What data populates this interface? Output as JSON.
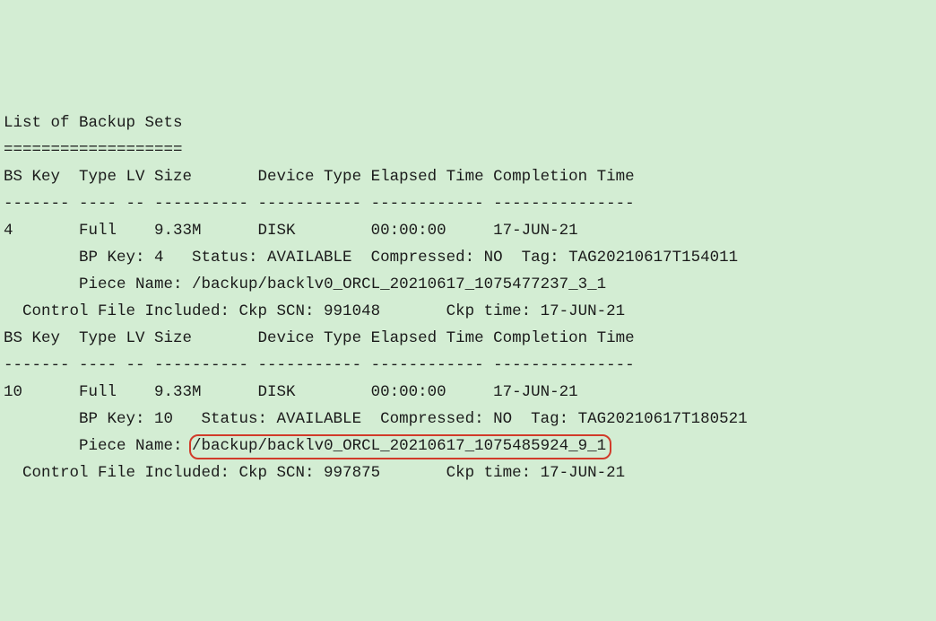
{
  "title": "List of Backup Sets",
  "divider": "===================",
  "header_line": "BS Key  Type LV Size       Device Type Elapsed Time Completion Time",
  "header_sep": "------- ---- -- ---------- ----------- ------------ ---------------",
  "sets": [
    {
      "summary_line": "4       Full    9.33M      DISK        00:00:00     17-JUN-21",
      "bp_line": "        BP Key: 4   Status: AVAILABLE  Compressed: NO  Tag: TAG20210617T154011",
      "piece_prefix": "        Piece Name: ",
      "piece_name": "/backup/backlv0_ORCL_20210617_1075477237_3_1",
      "piece_highlight": false,
      "control_line": "  Control File Included: Ckp SCN: 991048       Ckp time: 17-JUN-21"
    },
    {
      "summary_line": "10      Full    9.33M      DISK        00:00:00     17-JUN-21",
      "bp_line": "        BP Key: 10   Status: AVAILABLE  Compressed: NO  Tag: TAG20210617T180521",
      "piece_prefix": "        Piece Name: ",
      "piece_name": "/backup/backlv0_ORCL_20210617_1075485924_9_1",
      "piece_highlight": true,
      "control_line": "  Control File Included: Ckp SCN: 997875       Ckp time: 17-JUN-21"
    }
  ]
}
